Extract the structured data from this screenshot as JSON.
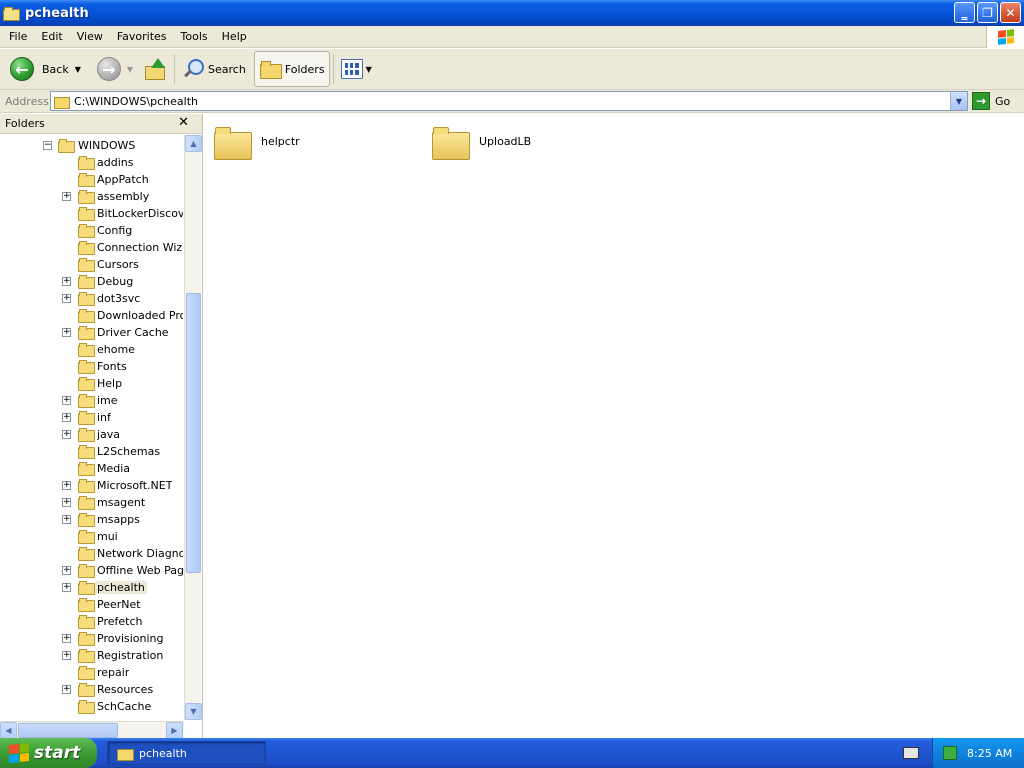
{
  "window": {
    "title": "pchealth"
  },
  "menu": [
    "File",
    "Edit",
    "View",
    "Favorites",
    "Tools",
    "Help"
  ],
  "toolbar": {
    "back_label": "Back",
    "search_label": "Search",
    "folders_label": "Folders"
  },
  "address": {
    "label": "Address",
    "value": "C:\\WINDOWS\\pchealth",
    "go_label": "Go"
  },
  "folders_pane": {
    "title": "Folders",
    "tree": [
      {
        "label": "WINDOWS",
        "expander": "−"
      },
      {
        "label": "addins",
        "expander": ""
      },
      {
        "label": "AppPatch",
        "expander": ""
      },
      {
        "label": "assembly",
        "expander": "+"
      },
      {
        "label": "BitLockerDiscover",
        "expander": ""
      },
      {
        "label": "Config",
        "expander": ""
      },
      {
        "label": "Connection Wizard",
        "expander": ""
      },
      {
        "label": "Cursors",
        "expander": ""
      },
      {
        "label": "Debug",
        "expander": "+"
      },
      {
        "label": "dot3svc",
        "expander": "+"
      },
      {
        "label": "Downloaded Progr",
        "expander": ""
      },
      {
        "label": "Driver Cache",
        "expander": "+"
      },
      {
        "label": "ehome",
        "expander": ""
      },
      {
        "label": "Fonts",
        "expander": ""
      },
      {
        "label": "Help",
        "expander": ""
      },
      {
        "label": "ime",
        "expander": "+"
      },
      {
        "label": "inf",
        "expander": "+"
      },
      {
        "label": "java",
        "expander": "+"
      },
      {
        "label": "L2Schemas",
        "expander": ""
      },
      {
        "label": "Media",
        "expander": ""
      },
      {
        "label": "Microsoft.NET",
        "expander": "+"
      },
      {
        "label": "msagent",
        "expander": "+"
      },
      {
        "label": "msapps",
        "expander": "+"
      },
      {
        "label": "mui",
        "expander": ""
      },
      {
        "label": "Network Diagnost",
        "expander": ""
      },
      {
        "label": "Offline Web Pages",
        "expander": "+"
      },
      {
        "label": "pchealth",
        "expander": "+",
        "selected": true
      },
      {
        "label": "PeerNet",
        "expander": ""
      },
      {
        "label": "Prefetch",
        "expander": ""
      },
      {
        "label": "Provisioning",
        "expander": "+"
      },
      {
        "label": "Registration",
        "expander": "+"
      },
      {
        "label": "repair",
        "expander": ""
      },
      {
        "label": "Resources",
        "expander": "+"
      },
      {
        "label": "SchCache",
        "expander": ""
      }
    ]
  },
  "content": {
    "items": [
      "helpctr",
      "UploadLB"
    ]
  },
  "taskbar": {
    "start_label": "start",
    "task_label": "pchealth",
    "clock": "8:25 AM"
  }
}
